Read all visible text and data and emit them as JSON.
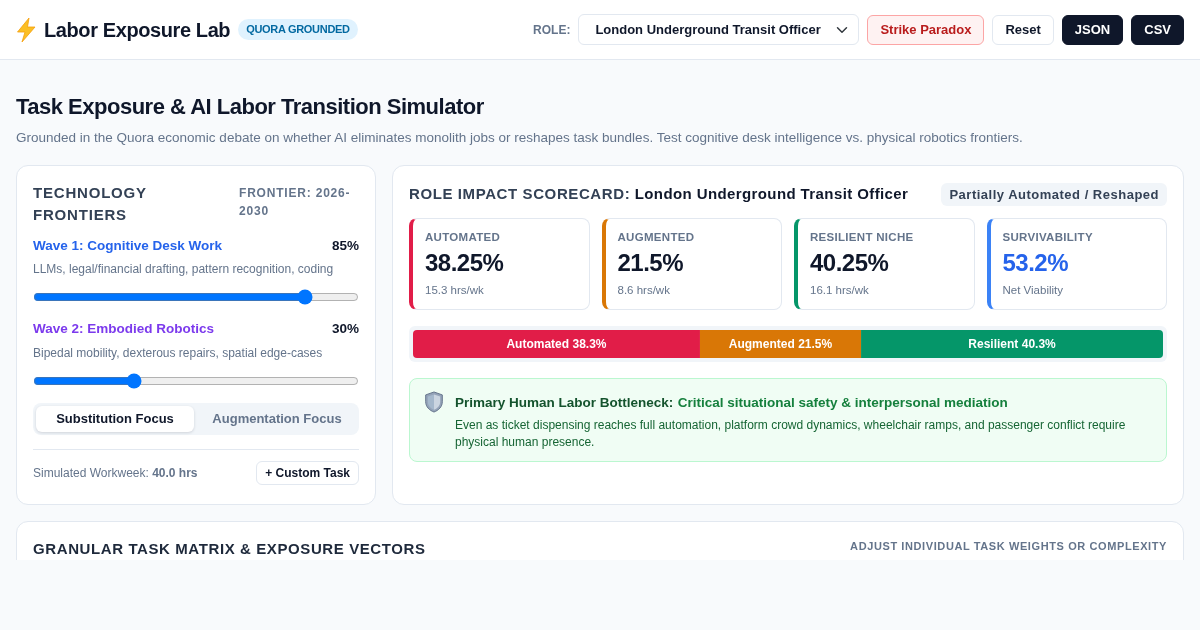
{
  "header": {
    "title": "Labor Exposure Lab",
    "badge": "QUORA GROUNDED",
    "role_label": "ROLE:",
    "role_select": {
      "value": "London Underground Transit Officer"
    },
    "buttons": [
      {
        "label": "Strike Paradox",
        "kind": "danger"
      },
      {
        "label": "Reset",
        "kind": "outline"
      },
      {
        "label": "JSON",
        "kind": "dark"
      },
      {
        "label": "CSV",
        "kind": "dark"
      }
    ]
  },
  "page": {
    "title": "Task Exposure & AI Labor Transition Simulator",
    "subtitle": "Grounded in the Quora economic debate on whether AI eliminates monolith jobs or reshapes task bundles. Test cognitive desk intelligence vs. physical robotics frontiers."
  },
  "frontiers": {
    "title": "TECHNOLOGY FRONTIERS",
    "range": "FRONTIER: 2026-2030",
    "waves": [
      {
        "name": "Wave 1: Cognitive Desk Work",
        "reading": "85%",
        "description": "LLMs, legal/financial drafting, pattern recognition, coding",
        "level": 0.85,
        "color": "#2563eb"
      },
      {
        "name": "Wave 2: Embodied Robotics",
        "reading": "30%",
        "description": "Bipedal mobility, dexterous repairs, spatial edge-cases",
        "level": 0.3,
        "color": "#7c3aed"
      }
    ],
    "focus_tabs": [
      {
        "label": "Substitution Focus",
        "selected": true
      },
      {
        "label": "Augmentation Focus",
        "selected": false
      }
    ],
    "workweek": "Simulated Workweek: **40.0 hrs**",
    "custom_task_button": "+ Custom Task"
  },
  "scorecard": {
    "title": "ROLE IMPACT SCORECARD:",
    "role": "London Underground Transit Officer",
    "status": "Partially Automated / Reshaped",
    "metrics": [
      {
        "kind": "share",
        "label": "AUTOMATED",
        "value": "38.25%",
        "detail": "15.3 hrs/wk",
        "color": "#e11d48"
      },
      {
        "kind": "share",
        "label": "AUGMENTED",
        "value": "21.5%",
        "detail": "8.6 hrs/wk",
        "color": "#d97706"
      },
      {
        "kind": "share",
        "label": "RESILIENT NICHE",
        "value": "40.25%",
        "detail": "16.1 hrs/wk",
        "color": "#059669"
      },
      {
        "kind": "score",
        "label": "SURVIVABILITY",
        "value": "53.2%",
        "detail": "Net Viability",
        "color": "#3b82f6"
      }
    ],
    "distribution": {
      "chart_data": {
        "type": "bar",
        "orientation": "horizontal",
        "stacked": true,
        "series": [
          {
            "name": "Automated",
            "color": "#e11d48",
            "values": [
              38.3
            ],
            "value_labels": [
              "38.3%"
            ]
          },
          {
            "name": "Augmented",
            "color": "#d97706",
            "values": [
              21.5
            ],
            "value_labels": [
              "21.5%"
            ]
          },
          {
            "name": "Resilient",
            "color": "#059669",
            "values": [
              40.3
            ],
            "value_labels": [
              "40.3%"
            ]
          }
        ]
      }
    },
    "bottleneck": {
      "label": "Primary Human Labor Bottleneck:",
      "value": "Critical situational safety & interpersonal mediation",
      "text": "Even as ticket dispensing reaches full automation, platform crowd dynamics, wheelchair ramps, and passenger conflict require physical human presence."
    }
  },
  "task_matrix": {
    "title": "GRANULAR TASK MATRIX & EXPOSURE VECTORS",
    "hint": "ADJUST INDIVIDUAL TASK WEIGHTS OR COMPLEXITY"
  }
}
